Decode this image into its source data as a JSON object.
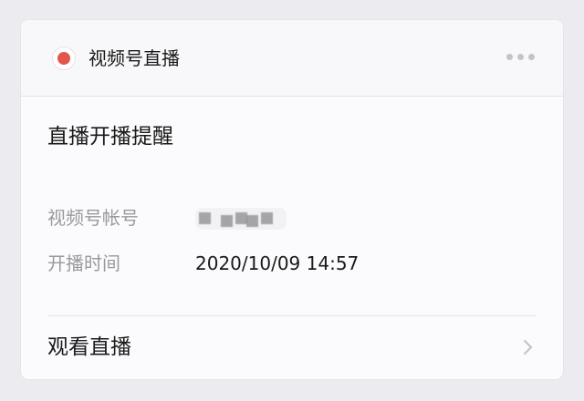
{
  "header": {
    "logo_icon": "live-record-icon",
    "title": "视频号直播",
    "more_icon": "more-dots-icon"
  },
  "card": {
    "title": "直播开播提醒",
    "fields": [
      {
        "label": "视频号帐号",
        "value": "",
        "value_obscured": true
      },
      {
        "label": "开播时间",
        "value": "2020/10/09 14:57"
      }
    ]
  },
  "footer": {
    "action_label": "观看直播",
    "chevron_icon": "chevron-right-icon"
  },
  "colors": {
    "page_background": "#ececf0",
    "card_background": "#fbfbfd",
    "record_red": "#e2574c",
    "label_gray": "#9a9a9e",
    "text_dark": "#1a1a1a"
  }
}
